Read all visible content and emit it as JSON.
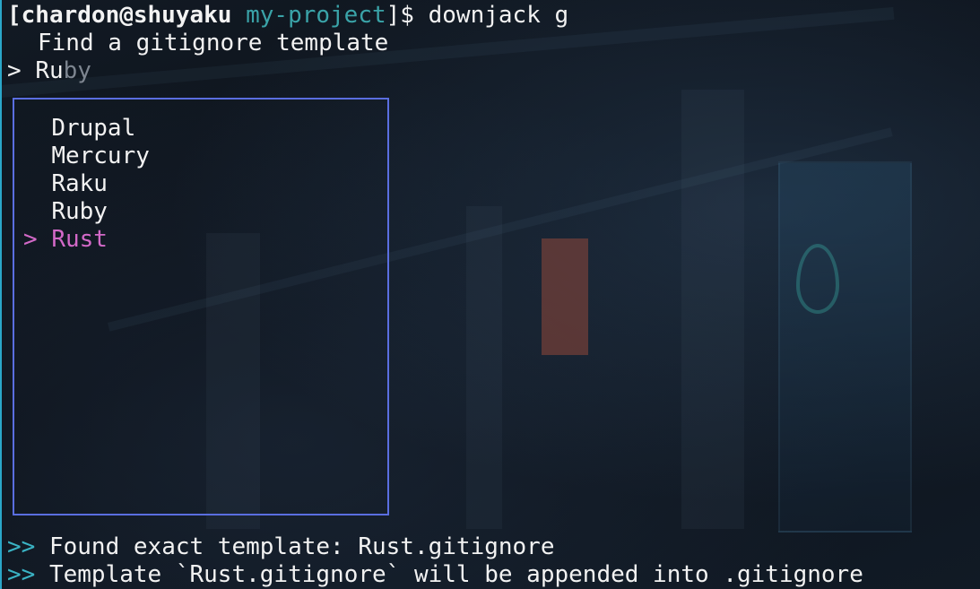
{
  "prompt": {
    "user_host": "[chardon@shuyaku",
    "dir": "my-project",
    "suffix": "]$ ",
    "command": "downjack g"
  },
  "finder": {
    "title": "Find a gitignore template",
    "query_marker": ">",
    "query_typed": "Ru",
    "query_suggestion": "by"
  },
  "list": {
    "items": [
      "Drupal",
      "Mercury",
      "Raku",
      "Ruby",
      "Rust"
    ],
    "selected_marker": ">",
    "selected_index": 4
  },
  "output": {
    "prefix": ">>",
    "lines": [
      "Found exact template: Rust.gitignore",
      "Template `Rust.gitignore` will be appended into .gitignore"
    ]
  },
  "colors": {
    "dir": "#3aa3a8",
    "selected": "#d369c8",
    "list_border": "#5a6ee0",
    "output_prefix": "#3ab3c4"
  }
}
